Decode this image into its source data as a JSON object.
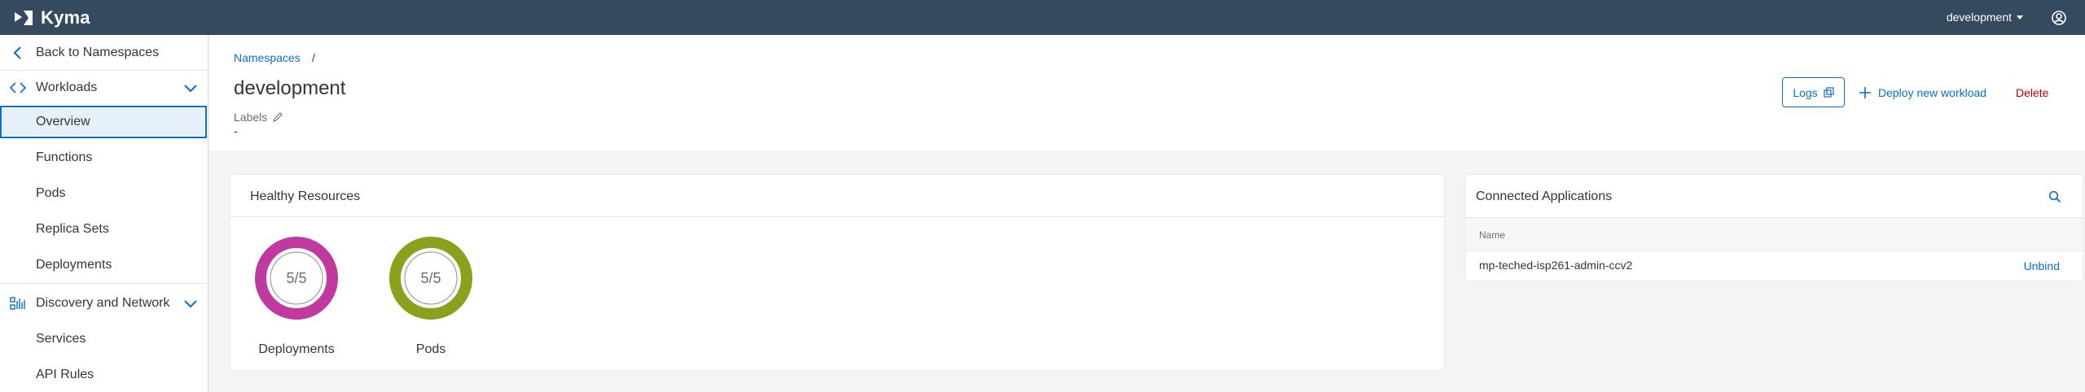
{
  "shell": {
    "brand": "Kyma",
    "namespace_selector": "development"
  },
  "sidebar": {
    "back": "Back to Namespaces",
    "groups": [
      {
        "label": "Workloads",
        "items": [
          "Overview",
          "Functions",
          "Pods",
          "Replica Sets",
          "Deployments"
        ]
      },
      {
        "label": "Discovery and Network",
        "items": [
          "Services",
          "API Rules"
        ]
      }
    ],
    "selected": "Overview"
  },
  "header": {
    "breadcrumb": "Namespaces",
    "breadcrumb_sep": "/",
    "title": "development",
    "labels_title": "Labels",
    "labels_value": "-",
    "logs_button": "Logs",
    "deploy_button": "Deploy new workload",
    "delete_button": "Delete"
  },
  "healthy": {
    "title": "Healthy Resources",
    "items": [
      {
        "label": "Deployments",
        "value": "5/5",
        "ready": 5,
        "total": 5,
        "color": "#c0399f"
      },
      {
        "label": "Pods",
        "value": "5/5",
        "ready": 5,
        "total": 5,
        "color": "#8ca01c"
      }
    ]
  },
  "apps": {
    "title": "Connected Applications",
    "column_name": "Name",
    "rows": [
      {
        "name": "mp-teched-isp261-admin-ccv2",
        "action": "Unbind"
      }
    ]
  },
  "colors": {
    "shell": "#354a5f",
    "accent": "#0a6ed1",
    "delete": "#bb0000"
  }
}
